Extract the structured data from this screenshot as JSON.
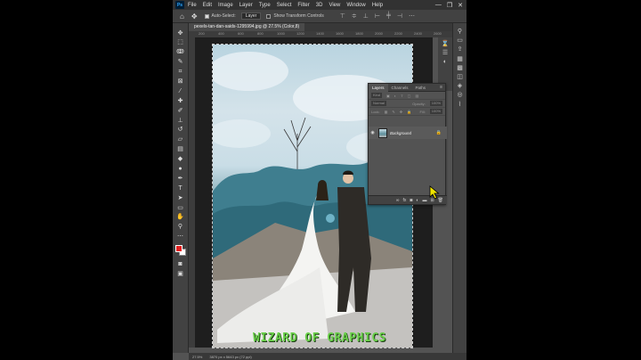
{
  "app": {
    "logo": "Ps",
    "menu": [
      "File",
      "Edit",
      "Image",
      "Layer",
      "Type",
      "Select",
      "Filter",
      "3D",
      "View",
      "Window",
      "Help"
    ],
    "window_controls": [
      "—",
      "❐",
      "✕"
    ]
  },
  "options_bar": {
    "auto_select_label": "Auto-Select:",
    "auto_select_value": "Layer",
    "transform_label": "Show Transform Controls"
  },
  "document": {
    "tab_title": "pexels-tan-dan-saids-1295994.jpg @ 27.5% (Color,8)",
    "zoom": "27.5%",
    "doc_info": "3870 px x 5643 px (72 ppi)",
    "ruler_marks": [
      "200",
      "400",
      "600",
      "800",
      "1000",
      "1200",
      "1400",
      "1600",
      "1800",
      "2000",
      "2200",
      "2400",
      "2600"
    ]
  },
  "layers_panel": {
    "tabs": [
      "Layers",
      "Channels",
      "Paths"
    ],
    "kind_label": "Kind",
    "blend_mode": "Normal",
    "opacity_label": "Opacity:",
    "opacity_value": "100%",
    "lock_label": "Lock:",
    "fill_label": "Fill:",
    "fill_value": "100%",
    "layer_name": "Background"
  },
  "watermark": "WIZARD OF GRAPHICS",
  "colors": {
    "foreground": "#e11e1e",
    "background": "#ffffff",
    "watermark": "#6ad04a"
  }
}
